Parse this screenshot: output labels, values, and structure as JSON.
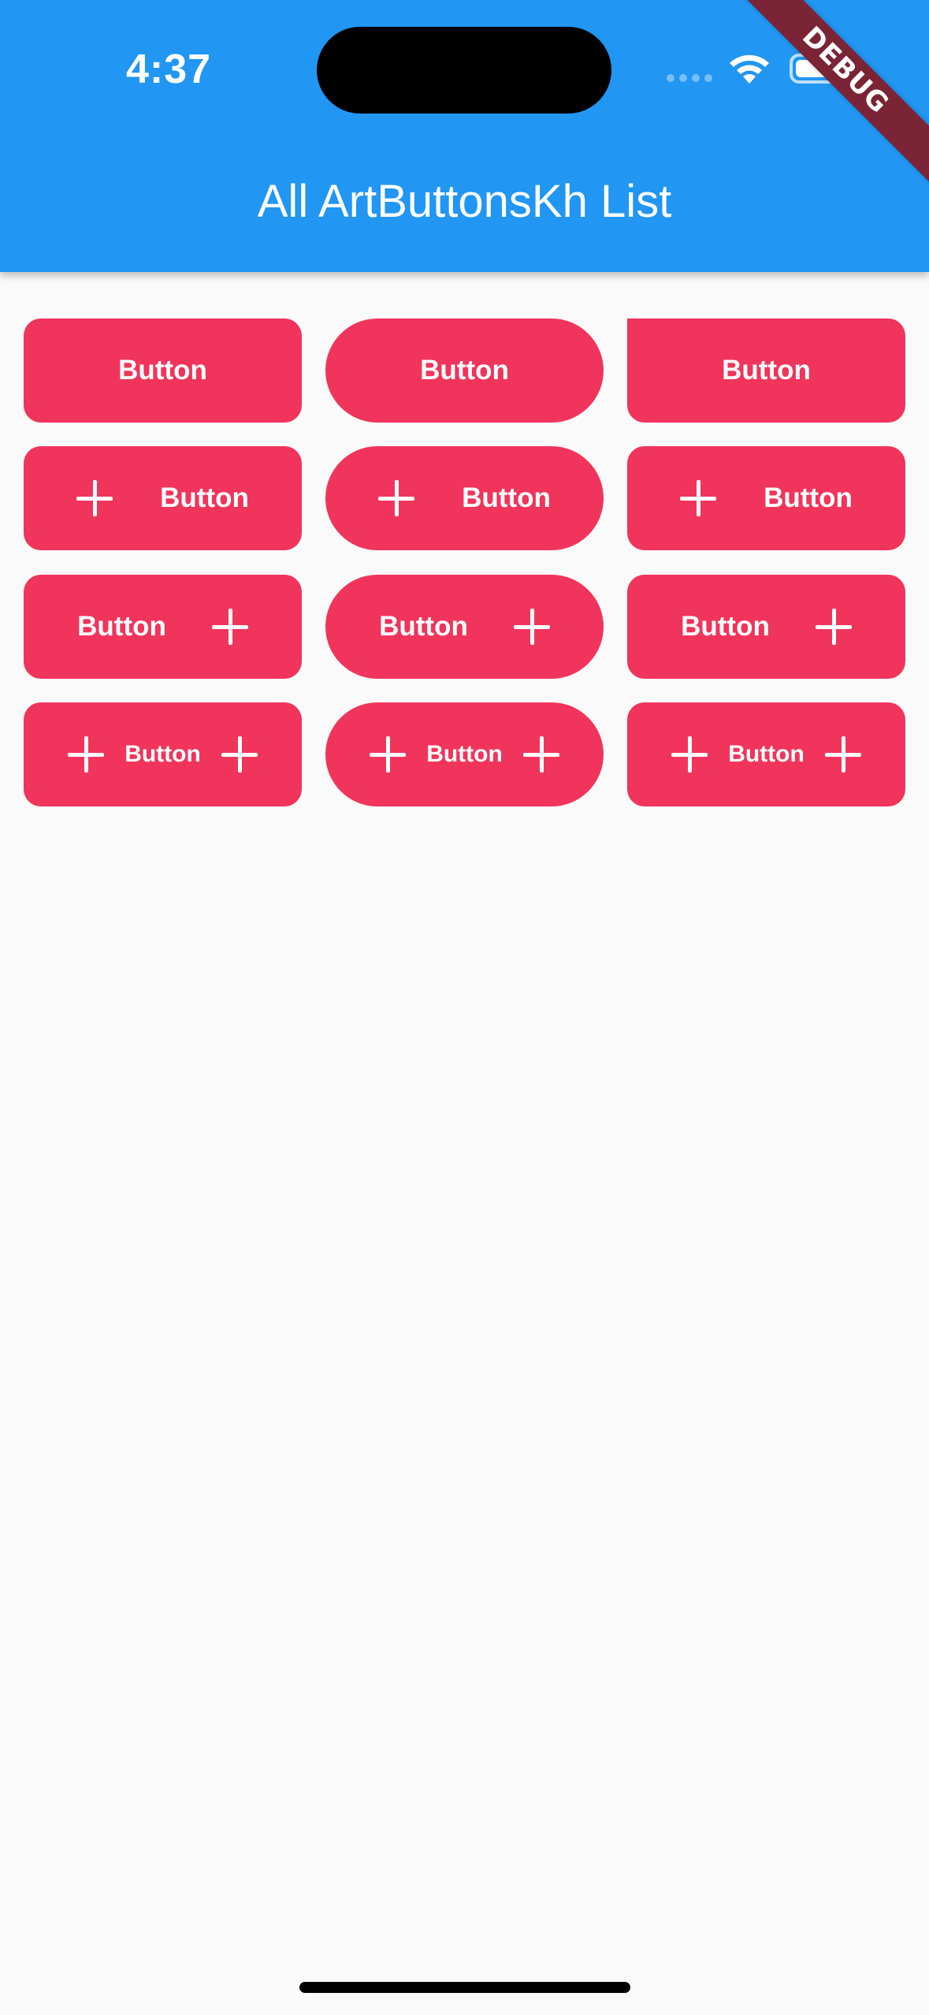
{
  "status_bar": {
    "time": "4:37",
    "icons": [
      "cellular-dots-icon",
      "wifi-icon",
      "battery-icon"
    ]
  },
  "debug_banner": "DEBUG",
  "app_bar": {
    "title": "All ArtButtonsKh List",
    "color": "#2196F3"
  },
  "button_color": "#f1345b",
  "buttons": {
    "r1c1": "Button",
    "r1c2": "Button",
    "r1c3": "Button",
    "r2c1": "Button",
    "r2c2": "Button",
    "r2c3": "Button",
    "r3c1": "Button",
    "r3c2": "Button",
    "r3c3": "Button",
    "r4c1": "Button",
    "r4c2": "Button",
    "r4c3": "Button"
  }
}
